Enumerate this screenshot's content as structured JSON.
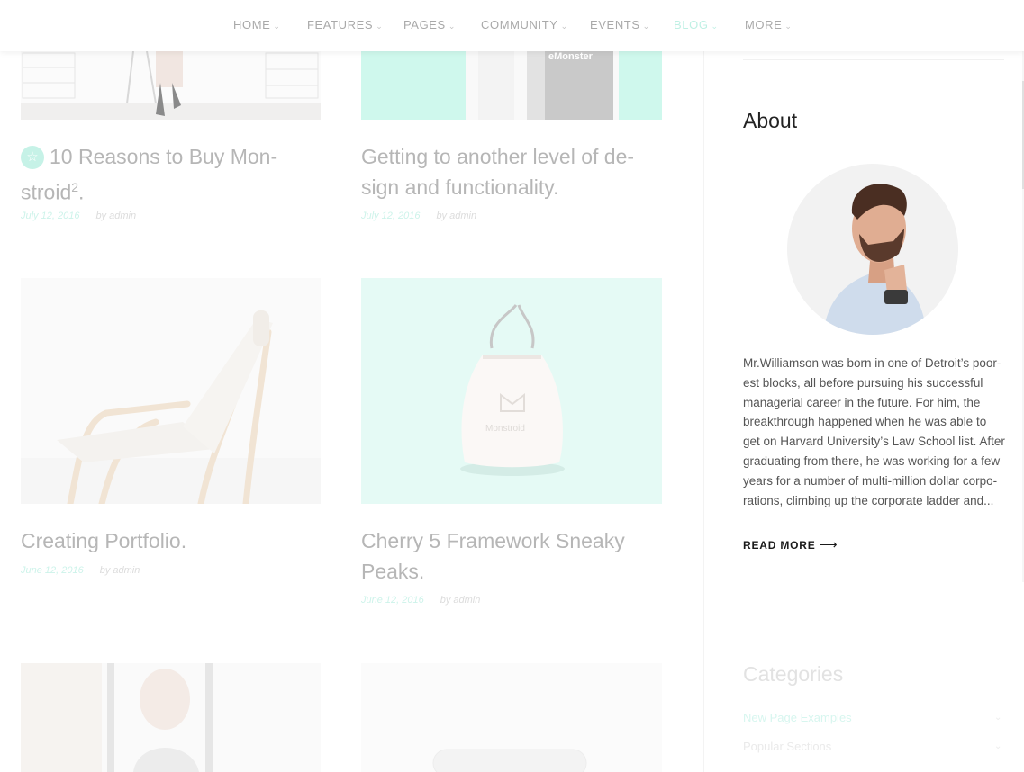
{
  "nav": {
    "items": [
      {
        "label": "HOME",
        "active": false
      },
      {
        "label": "FEATURES",
        "active": false
      },
      {
        "label": "PAGES",
        "active": false
      },
      {
        "label": "COMMUNITY",
        "active": false
      },
      {
        "label": "EVENTS",
        "active": false
      },
      {
        "label": "BLOG",
        "active": true
      },
      {
        "label": "MORE",
        "active": false
      }
    ]
  },
  "posts": [
    {
      "title_a": "10 Reasons to Buy Mon-",
      "title_b": "stroid",
      "title_sup": "2",
      "title_end": ".",
      "date": "July 12, 2016",
      "author": "by admin",
      "featured": true
    },
    {
      "title_a": "Getting to another level of de-",
      "title_b": "sign and functionality.",
      "date": "July 12, 2016",
      "author": "by admin"
    },
    {
      "title_a": "Creating Portfolio.",
      "date": "June 12, 2016",
      "author": "by admin"
    },
    {
      "title_a": "Cherry 5 Framework Sneaky",
      "title_b": "Peaks.",
      "date": "June 12, 2016",
      "author": "by admin"
    }
  ],
  "thumb_texts": {
    "monster_label": "eMonster",
    "bag_label": "Monstroid"
  },
  "sidebar": {
    "about": {
      "title": "About",
      "text": "Mr.Williamson was born in one of Detroit’s poor-est blocks, all before pursuing his successful managerial career in the future. For him, the breakthrough happened when he was able to get on Harvard University’s Law School list. After graduating from there, he was working for a few years for a number of multi-million dollar corpo-rations, climbing up the corporate ladder and...",
      "read_more": "READ MORE"
    },
    "categories": {
      "title": "Categories",
      "items": [
        "New Page Examples",
        "Popular Sections"
      ]
    }
  },
  "colors": {
    "accent": "#bff0e4",
    "title_gray": "#b6b6b6",
    "text": "#555555"
  }
}
